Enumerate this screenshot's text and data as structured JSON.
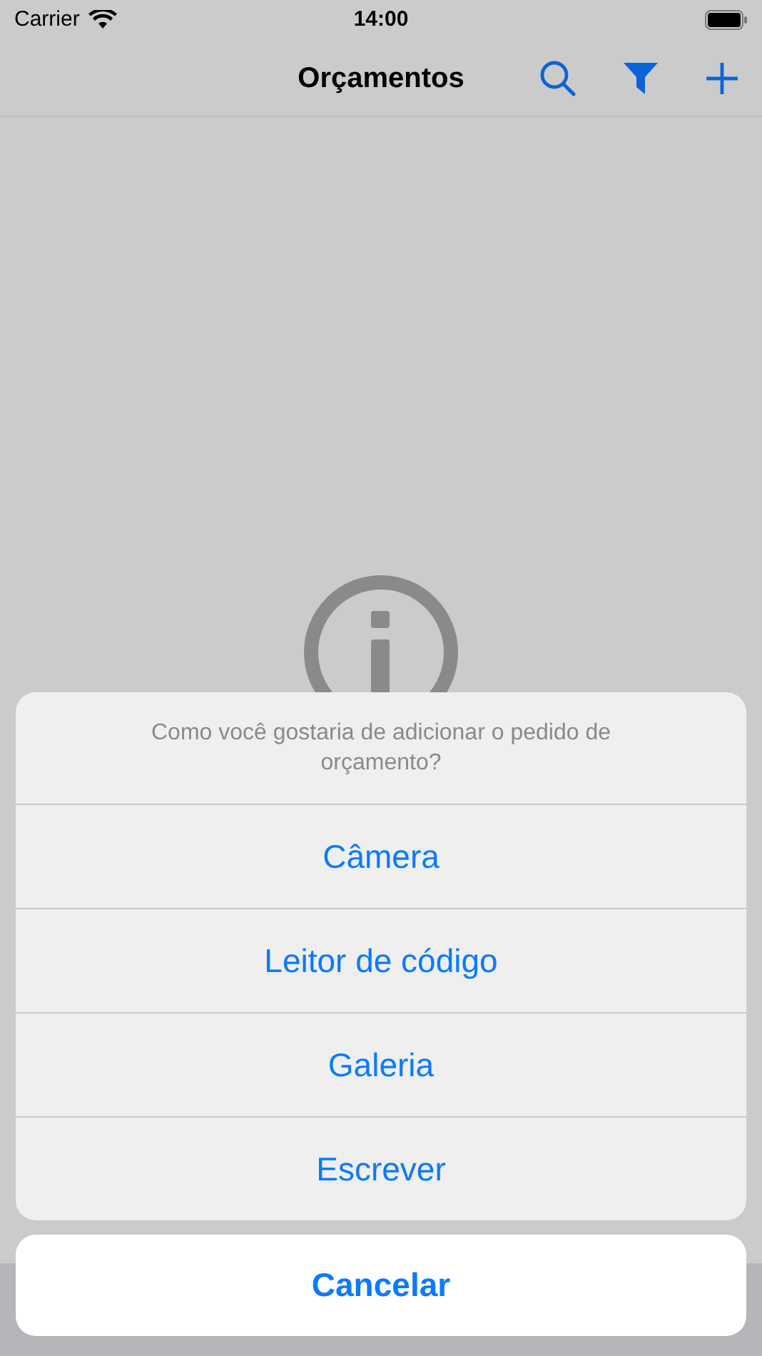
{
  "status_bar": {
    "carrier": "Carrier",
    "time": "14:00"
  },
  "nav_bar": {
    "title": "Orçamentos"
  },
  "action_sheet": {
    "message": "Como você gostaria de adicionar o pedido de orçamento?",
    "actions": [
      "Câmera",
      "Leitor de código",
      "Galeria",
      "Escrever"
    ],
    "cancel": "Cancelar"
  }
}
